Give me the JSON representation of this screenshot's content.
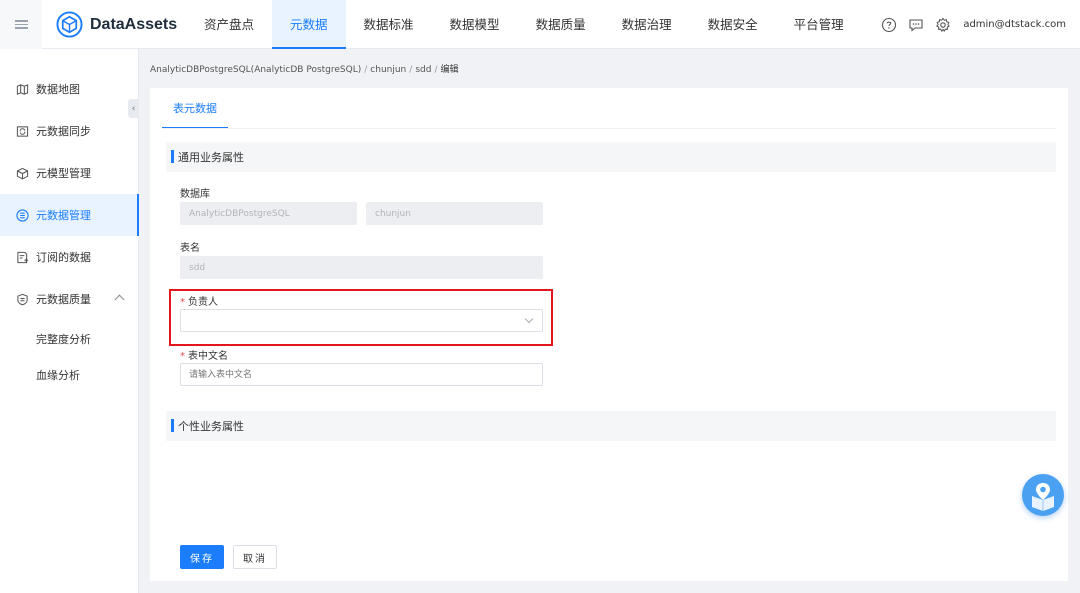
{
  "app": {
    "name": "DataAssets",
    "accent": "#1b7dfb"
  },
  "nav": {
    "items": [
      {
        "label": "资产盘点"
      },
      {
        "label": "元数据"
      },
      {
        "label": "数据标准"
      },
      {
        "label": "数据模型"
      },
      {
        "label": "数据质量"
      },
      {
        "label": "数据治理"
      },
      {
        "label": "数据安全"
      },
      {
        "label": "平台管理"
      }
    ],
    "active_index": 1
  },
  "header": {
    "icons": [
      "help-circle-icon",
      "message-icon",
      "gear-icon"
    ],
    "user": "admin@dtstack.com"
  },
  "sidebar": {
    "items": [
      {
        "label": "数据地图",
        "icon": "map-icon"
      },
      {
        "label": "元数据同步",
        "icon": "sync-icon"
      },
      {
        "label": "元模型管理",
        "icon": "cube-icon"
      },
      {
        "label": "元数据管理",
        "icon": "database-icon"
      },
      {
        "label": "订阅的数据",
        "icon": "subscribe-icon"
      },
      {
        "label": "元数据质量",
        "icon": "shield-icon"
      }
    ],
    "active_index": 3,
    "sub_items": [
      {
        "label": "完整度分析"
      },
      {
        "label": "血缘分析"
      }
    ]
  },
  "breadcrumb": {
    "items": [
      "AnalyticDBPostgreSQL(AnalyticDB PostgreSQL)",
      "chunjun",
      "sdd",
      "编辑"
    ],
    "separator": "/"
  },
  "tabs": [
    {
      "label": "表元数据"
    }
  ],
  "sections": {
    "common": {
      "title": "通用业务属性"
    },
    "custom": {
      "title": "个性业务属性"
    }
  },
  "form": {
    "database": {
      "label": "数据库",
      "value_db": "AnalyticDBPostgreSQL",
      "value_schema": "chunjun"
    },
    "table_name": {
      "label": "表名",
      "value": "sdd"
    },
    "owner": {
      "label": "负责人",
      "required": "*",
      "value": ""
    },
    "table_cn_name": {
      "label": "表中文名",
      "required": "*",
      "placeholder": "请输入表中文名"
    }
  },
  "buttons": {
    "save": "保存",
    "cancel": "取消"
  },
  "highlight_color": "#e3161c"
}
